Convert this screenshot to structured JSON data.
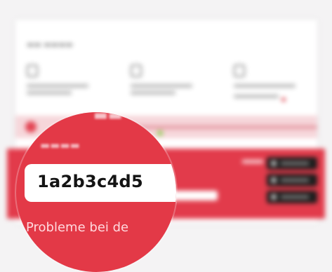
{
  "magnifier": {
    "code_value": "1a2b3c4d5",
    "problem_text": "Probleme bei de"
  },
  "colors": {
    "accent_red": "#e33947",
    "code_box": "#ffffff",
    "code_text": "#141414"
  }
}
